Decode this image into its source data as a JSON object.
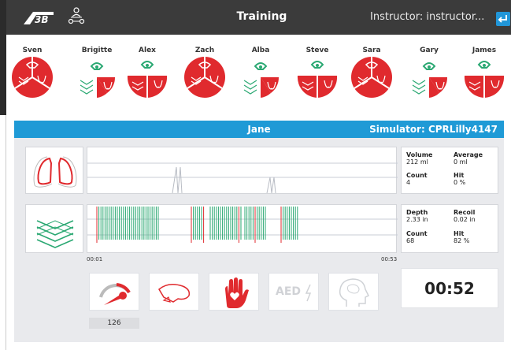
{
  "header": {
    "title": "Training",
    "instructor": "Instructor: instructor...",
    "exit_icon": "return-icon"
  },
  "students": [
    {
      "name": "Sven",
      "style": "full"
    },
    {
      "name": "Brigitte",
      "style": "partial"
    },
    {
      "name": "Alex",
      "style": "split"
    },
    {
      "name": "Zach",
      "style": "full"
    },
    {
      "name": "Alba",
      "style": "partial"
    },
    {
      "name": "Steve",
      "style": "split"
    },
    {
      "name": "Sara",
      "style": "full"
    },
    {
      "name": "Gary",
      "style": "partial"
    },
    {
      "name": "James",
      "style": "split"
    }
  ],
  "panel": {
    "student_name": "Jane",
    "simulator": "Simulator: CPRLilly4147",
    "ventilation": {
      "volume_label": "Volume",
      "volume_value": "212  ml",
      "average_label": "Average",
      "average_value": "0  ml",
      "count_label": "Count",
      "count_value": "4",
      "hit_label": "Hit",
      "hit_value": "0  %"
    },
    "compression": {
      "depth_label": "Depth",
      "depth_value": "2.33  in",
      "recoil_label": "Recoil",
      "recoil_value": "0.02  in",
      "count_label": "Count",
      "count_value": "68",
      "hit_label": "Hit",
      "hit_value": "82  %"
    },
    "time_start": "00:01",
    "time_end": "00:53",
    "pressure_value": "126",
    "aed_label": "AED",
    "timer": "00:52"
  },
  "colors": {
    "red": "#e02a2e",
    "green": "#2aa872",
    "blue": "#1f9ad6",
    "dark": "#3b3b3b"
  }
}
